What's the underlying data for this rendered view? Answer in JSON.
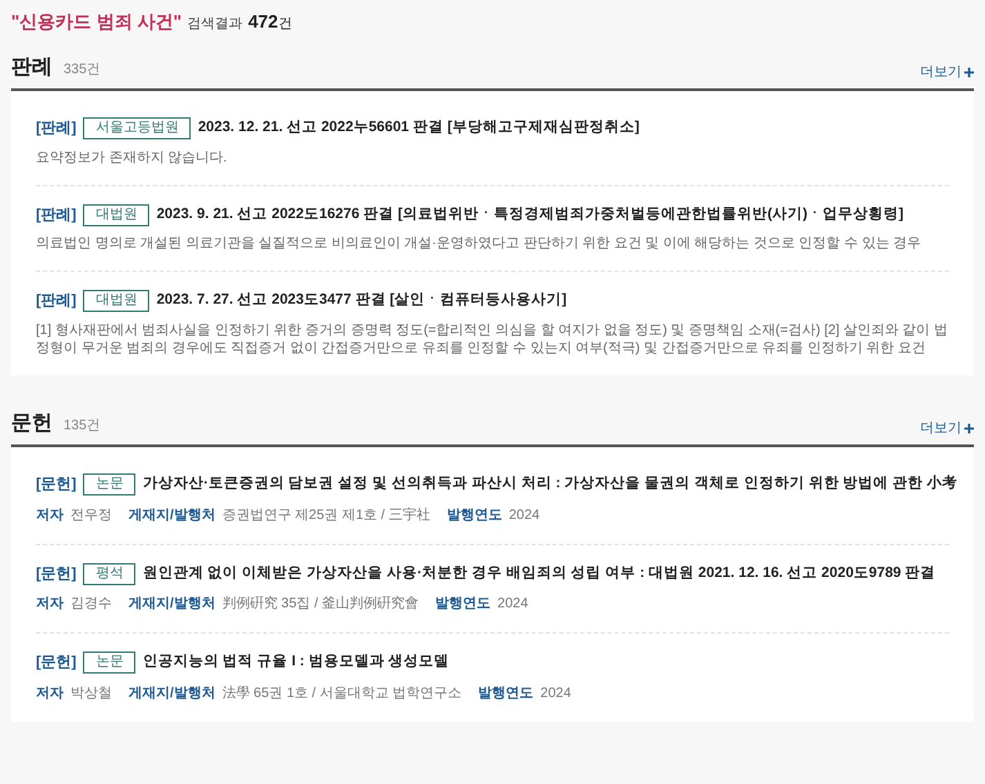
{
  "query": "\"신용카드 범죄 사건\"",
  "result_label": "검색결과",
  "total": "472",
  "total_unit": "건",
  "sections": [
    {
      "title": "판례",
      "count": "335건",
      "more": "더보기",
      "items": [
        {
          "kind": "case",
          "tag": "[판례]",
          "badge": "서울고등법원",
          "title": "2023. 12. 21. 선고 2022누56601 판결 [부당해고구제재심판정취소]",
          "summary": "요약정보가 존재하지 않습니다."
        },
        {
          "kind": "case",
          "tag": "[판례]",
          "badge": "대법원",
          "title": "2023. 9. 21. 선고 2022도16276 판결 [의료법위반ㆍ특정경제범죄가중처벌등에관한법률위반(사기)ㆍ업무상횡령]",
          "summary": "의료법인 명의로 개설된 의료기관을 실질적으로 비의료인이 개설·운영하였다고 판단하기 위한 요건 및 이에 해당하는 것으로 인정할 수 있는 경우"
        },
        {
          "kind": "case",
          "tag": "[판례]",
          "badge": "대법원",
          "title": "2023. 7. 27. 선고 2023도3477 판결 [살인ㆍ컴퓨터등사용사기]",
          "summary": "[1] 형사재판에서 범죄사실을 인정하기 위한 증거의 증명력 정도(=합리적인 의심을 할 여지가 없을 정도) 및 증명책임 소재(=검사) [2] 살인죄와 같이 법정형이 무거운 범죄의 경우에도 직접증거 없이 간접증거만으로 유죄를 인정할 수 있는지 여부(적극) 및 간접증거만으로 유죄를 인정하기 위한 요건"
        }
      ]
    },
    {
      "title": "문헌",
      "count": "135건",
      "more": "더보기",
      "items": [
        {
          "kind": "paper",
          "tag": "[문헌]",
          "badge": "논문",
          "title": "가상자산·토큰증권의 담보권 설정 및 선의취득과 파산시 처리 : 가상자산을 물권의 객체로 인정하기 위한 방법에 관한 小考",
          "meta": [
            {
              "label": "저자",
              "value": "전우정"
            },
            {
              "label": "게재지/발행처",
              "value": "증권법연구 제25권 제1호 / 三宇社"
            },
            {
              "label": "발행연도",
              "value": "2024"
            }
          ]
        },
        {
          "kind": "paper",
          "tag": "[문헌]",
          "badge": "평석",
          "title": "원인관계 없이 이체받은 가상자산을 사용·처분한 경우 배임죄의 성립 여부 : 대법원 2021. 12. 16. 선고 2020도9789 판결",
          "meta": [
            {
              "label": "저자",
              "value": "김경수"
            },
            {
              "label": "게재지/발행처",
              "value": "判例硏究 35집 / 釜山判例硏究會"
            },
            {
              "label": "발행연도",
              "value": "2024"
            }
          ]
        },
        {
          "kind": "paper",
          "tag": "[문헌]",
          "badge": "논문",
          "title": "인공지능의 법적 규율 I : 범용모델과 생성모델",
          "meta": [
            {
              "label": "저자",
              "value": "박상철"
            },
            {
              "label": "게재지/발행처",
              "value": "法學 65권 1호 / 서울대학교 법학연구소"
            },
            {
              "label": "발행연도",
              "value": "2024"
            }
          ]
        }
      ]
    }
  ]
}
